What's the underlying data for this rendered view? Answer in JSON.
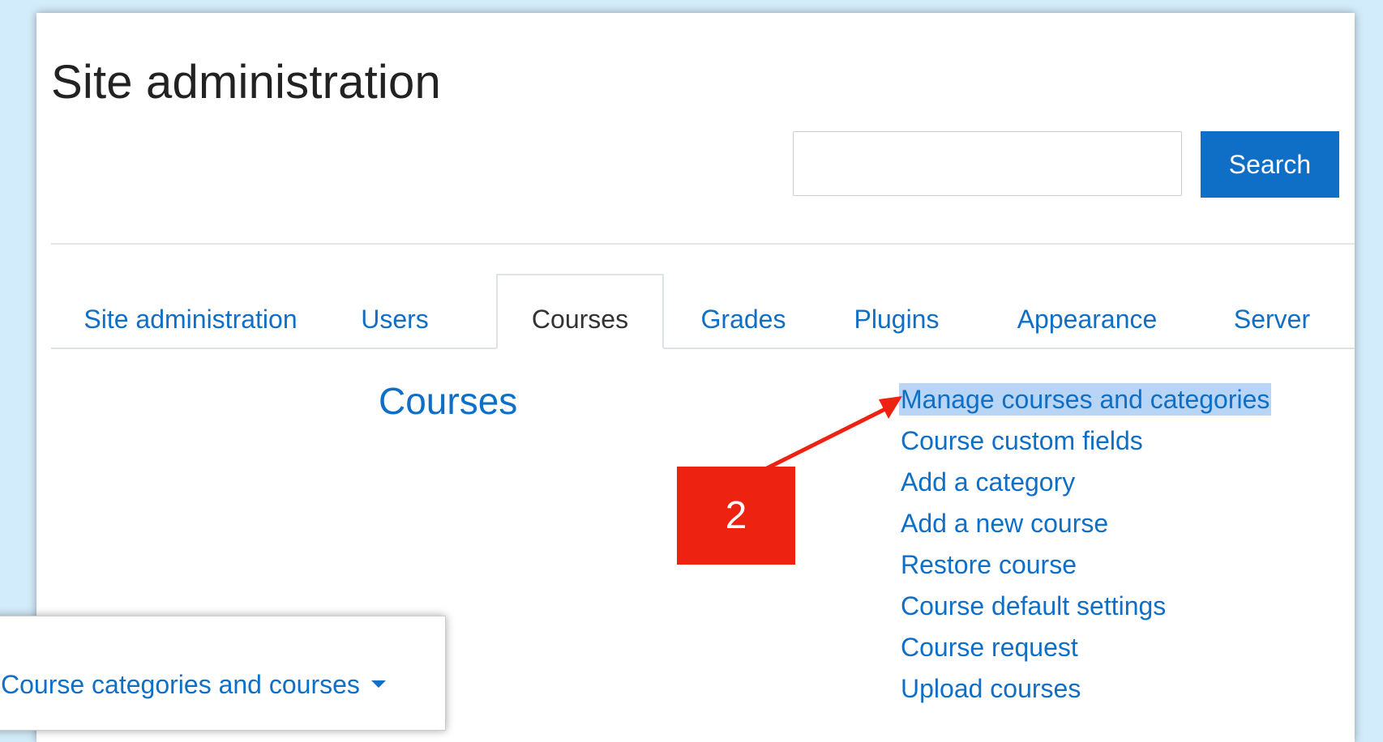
{
  "header": {
    "title": "Site administration",
    "search_placeholder": "",
    "search_button": "Search"
  },
  "tabs": [
    {
      "label": "Site administration",
      "active": false
    },
    {
      "label": "Users",
      "active": false
    },
    {
      "label": "Courses",
      "active": true
    },
    {
      "label": "Grades",
      "active": false
    },
    {
      "label": "Plugins",
      "active": false
    },
    {
      "label": "Appearance",
      "active": false
    },
    {
      "label": "Server",
      "active": false
    }
  ],
  "courses_section": {
    "heading": "Courses",
    "links": [
      "Manage courses and categories",
      "Course custom fields",
      "Add a category",
      "Add a new course",
      "Restore course",
      "Course default settings",
      "Course request",
      "Upload courses"
    ],
    "highlighted_index": 0
  },
  "annotation": {
    "step_label": "2",
    "color": "#ee2211"
  },
  "dropdown": {
    "label": "Course categories and courses",
    "icon": "caret-down-icon"
  },
  "colors": {
    "link": "#0f6fc6",
    "button_bg": "#0f6fc6",
    "highlight": "#b8d5f5",
    "background": "#d3ecfb"
  }
}
